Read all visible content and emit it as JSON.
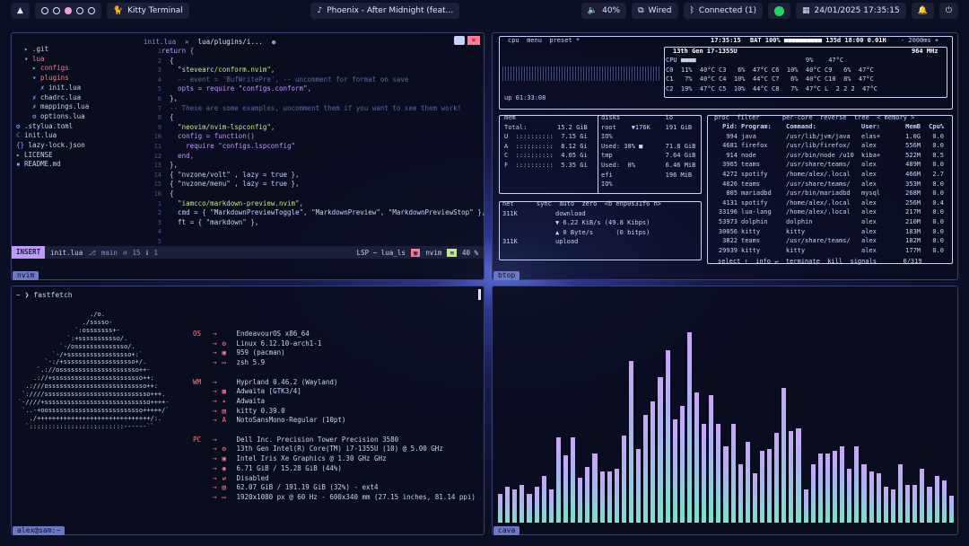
{
  "topbar": {
    "terminal": "Kitty Terminal",
    "media": "Phoenix - After Midnight (feat...",
    "volume": "40%",
    "network": "Wired",
    "bluetooth": "Connected (1)",
    "datetime": "24/01/2025 17:35:15"
  },
  "nvim": {
    "tag": "nvim",
    "tabs": [
      "init.lua",
      "lua/plugins/i..."
    ],
    "tree": [
      ".git",
      "lua",
      "configs",
      "plugins",
      "init.lua",
      "chadrc.lua",
      "mappings.lua",
      "options.lua",
      ".stylua.toml",
      "init.lua",
      "lazy-lock.json",
      "LICENSE",
      "README.md"
    ],
    "gutter": [
      "1",
      "2",
      "3",
      "4",
      "5",
      "6",
      "7",
      "8",
      "9",
      "10",
      "11",
      "12",
      "13",
      "14",
      "15",
      "16",
      "1",
      "2",
      "3",
      "4",
      "5"
    ],
    "code": [
      "return {",
      "  {",
      "    \"stevearc/conform.nvim\",",
      "    -- event = 'BufWritePre', -- uncomment for format on save",
      "    opts = require \"configs.conform\",",
      "  },",
      "",
      "  -- These are some examples, uncomment them if you want to see them work!",
      "  {",
      "    \"neovim/nvim-lspconfig\",",
      "    config = function()",
      "      require \"configs.lspconfig\"",
      "    end,",
      "  },",
      "  { \"nvzone/volt\" , lazy = true },",
      "  { \"nvzone/menu\" , lazy = true },",
      "  {",
      "    \"iamcco/markdown-preview.nvim\",",
      "    cmd = { \"MarkdownPreviewToggle\", \"MarkdownPreview\", \"MarkdownPreviewStop\" },",
      "",
      "    ft = { \"markdown\" },"
    ],
    "status": {
      "mode": "INSERT",
      "file": "init.lua",
      "branch": "main",
      "warn": "15",
      "err": "1",
      "lsp": "LSP ~ lua_ls",
      "app": "nvim",
      "pct": "40 %"
    }
  },
  "btop": {
    "tag": "btop",
    "cpu_header": "cpu  menu  preset *",
    "clock": "17:35:15",
    "bat": "BAT 100% ■■■■■■■■■■ 135d 18:00 0.01H",
    "interval": "- 2000ms +",
    "model": "13th Gen i7-1355U",
    "freq": "964 MHz",
    "cpu_lines": [
      "CPU ■■■■                             9%    47°C",
      "C0  11%  40°C C3   6%  47°C C6  10%  40°C C9   6%  47°C",
      "C1   7%  40°C C4  10%  44°C C7   6%  40°C C10  8%  47°C",
      "C2  19%  47°C C5  10%  44°C C8   7%  47°C L  2 2 2  47°C"
    ],
    "uptime": "up 01:33:08",
    "mem": [
      "mem",
      "Total:        15.2 GiB",
      "U  ::::::::::  7.15 Gi",
      "A  ::::::::::  8.12 Gi",
      "C  ::::::::::  4.05 Gi",
      "F  ::::::::::  5.35 Gi"
    ],
    "disks": [
      "disks            io",
      "root    ▼176K    191 GiB",
      "IO%",
      "Used: 38% ■      71.8 GiB",
      "tmp              7.64 GiB",
      "Used:  0%        6.46 MiB",
      "efi              196 MiB",
      "IO%"
    ],
    "net": [
      "net      sync  auto  zero  <b enp0s31f6 n>",
      "311K          download",
      "              ▼ 6.22 KiB/s (49.8 Kibps)",
      "",
      "              ▲ 0 Byte/s      (0 bitps)",
      "311K          upload"
    ],
    "proc_header": "proc  filter      per-core  reverse  tree  < memory >",
    "proc": [
      [
        "Pid:",
        "Program:",
        "Command:",
        "User:",
        "MemB",
        "Cpu%"
      ],
      [
        "994",
        "java",
        "/usr/lib/jvm/java",
        "elas+",
        "1.0G",
        "0.0"
      ],
      [
        "4681",
        "firefox",
        "/usr/lib/firefox/",
        "alex",
        "556M",
        "0.0"
      ],
      [
        "914",
        "node",
        "/usr/bin/node /u10",
        "kiba+",
        "522M",
        "0.5"
      ],
      [
        "3965",
        "teams",
        "/usr/share/teams/",
        "alex",
        "489M",
        "0.0"
      ],
      [
        "4272",
        "spotify",
        "/home/alex/.local",
        "alex",
        "466M",
        "2.7"
      ],
      [
        "4026",
        "teams",
        "/usr/share/teams/",
        "alex",
        "353M",
        "0.0"
      ],
      [
        "805",
        "mariadbd",
        "/usr/bin/mariadbd",
        "mysql",
        "268M",
        "0.0"
      ],
      [
        "4131",
        "spotify",
        "/home/alex/.local",
        "alex",
        "256M",
        "0.4"
      ],
      [
        "33196",
        "lua-lang",
        "/home/alex/.local",
        "alex",
        "217M",
        "0.0"
      ],
      [
        "53973",
        "dolphin",
        "dolphin",
        "alex",
        "210M",
        "0.0"
      ],
      [
        "30056",
        "kitty",
        "kitty",
        "alex",
        "183M",
        "0.0"
      ],
      [
        "3822",
        "teams",
        "/usr/share/teams/",
        "alex",
        "182M",
        "0.0"
      ],
      [
        "29939",
        "kitty",
        "kitty",
        "alex",
        "177M",
        "0.0"
      ]
    ],
    "proc_footer": "select ↑  info ↵  terminate  kill  signals       0/319"
  },
  "fastfetch": {
    "prompt": "~ ❯ fastfetch",
    "tag": "alex@sam:~",
    "logo": "                   ./o.\n                 ./sssso-\n               `:osssssss+-\n             `:+sssssssssso/.\n           `-/ossssssssssssso/.\n         `-/+sssssssssssssssso+:`\n       `-:/+sssssssssssssssssso+/.\n     `.://osssssssssssssssssssso++-\n    .://+ssssssssssssssssssssssso++:\n  .:///ossssssssssssssssssssssssso++:\n `:////ssssssssssssssssssssssssssso+++.\n`-////+ssssssssssssssssssssssssssso++++-\n `..-+oosssssssssssssssssssssssso+++++/`\n   ./++++++++++++++++++++++++++++++/:.\n  `:::::::::::::::::::::::::------``",
    "os": [
      [
        "OS",
        "",
        "EndeavourOS x86_64"
      ],
      [
        "",
        "⚙",
        "Linux 6.12.10-arch1-1"
      ],
      [
        "",
        "▣",
        "959 (pacman)"
      ],
      [
        "",
        "▭",
        "zsh 5.9"
      ]
    ],
    "wm": [
      [
        "WM",
        "",
        "Hyprland 0.46.2 (Wayland)"
      ],
      [
        "",
        "▦",
        "Adwaita [GTK3/4]"
      ],
      [
        "",
        "✦",
        "Adwaita"
      ],
      [
        "",
        "▤",
        "kitty 0.39.0"
      ],
      [
        "",
        "A",
        "NotoSansMono-Regular (10pt)"
      ]
    ],
    "pc": [
      [
        "PC",
        "",
        "Dell Inc. Precision Tower Precision 3580"
      ],
      [
        "",
        "⚙",
        "13th Gen Intel(R) Core(TM) i7-1355U (10) @ 5.00 GHz"
      ],
      [
        "",
        "▣",
        "Intel Iris Xe Graphics @ 1.30 GHz GHz"
      ],
      [
        "",
        "◉",
        "6.71 GiB / 15.28 GiB (44%)"
      ],
      [
        "",
        "⇄",
        "Disabled"
      ],
      [
        "",
        "▤",
        "62.07 GiB / 191.19 GiB (32%) - ext4"
      ],
      [
        "",
        "▭",
        "1920x1080 px @ 60 Hz - 600x340 mm (27.15 inches, 81.14 ppi)"
      ]
    ]
  },
  "cava": {
    "tag": "cava",
    "levels": [
      0.13,
      0.16,
      0.15,
      0.17,
      0.13,
      0.16,
      0.21,
      0.15,
      0.38,
      0.3,
      0.38,
      0.2,
      0.25,
      0.31,
      0.23,
      0.23,
      0.24,
      0.39,
      0.72,
      0.33,
      0.48,
      0.54,
      0.65,
      0.77,
      0.46,
      0.52,
      0.85,
      0.58,
      0.44,
      0.57,
      0.44,
      0.34,
      0.44,
      0.26,
      0.36,
      0.22,
      0.32,
      0.33,
      0.4,
      0.6,
      0.41,
      0.42,
      0.15,
      0.26,
      0.31,
      0.31,
      0.32,
      0.34,
      0.24,
      0.34,
      0.26,
      0.23,
      0.22,
      0.16,
      0.15,
      0.26,
      0.17,
      0.17,
      0.24,
      0.16,
      0.21,
      0.19,
      0.12
    ]
  }
}
